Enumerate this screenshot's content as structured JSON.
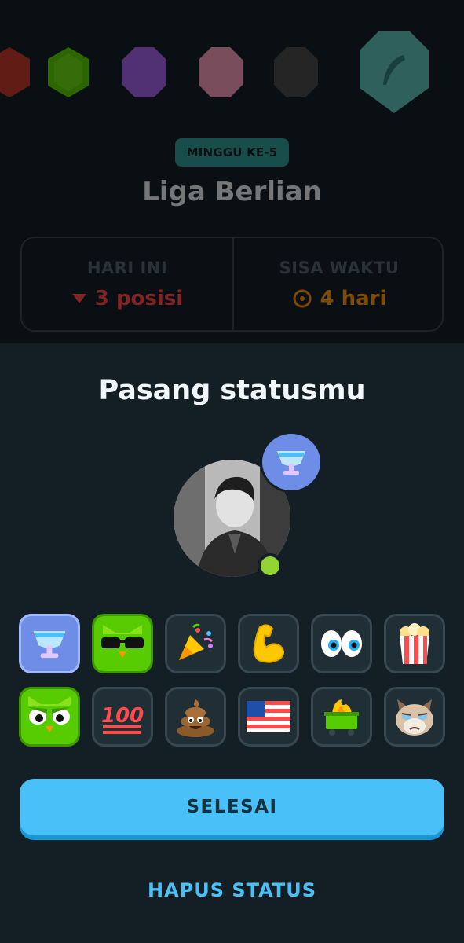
{
  "league": {
    "week_label": "MINGGU KE-5",
    "title": "Liga Berlian",
    "stats": {
      "today_label": "HARI INI",
      "today_value": "3 posisi",
      "remaining_label": "SISA WAKTU",
      "remaining_value": "4 hari"
    },
    "badges": [
      {
        "name": "ruby-league-badge",
        "color": "#c0392b"
      },
      {
        "name": "emerald-league-badge",
        "color": "#58cc02"
      },
      {
        "name": "amethyst-league-badge",
        "color": "#a560e8"
      },
      {
        "name": "pearl-league-badge",
        "color": "#f49ab8"
      },
      {
        "name": "obsidian-league-badge",
        "color": "#4b4b4b"
      },
      {
        "name": "diamond-league-badge",
        "color": "#60c1b8"
      }
    ]
  },
  "sheet": {
    "title": "Pasang statusmu",
    "selected_status": "trophy-icon",
    "status_options": [
      {
        "name": "trophy-icon",
        "selected": true
      },
      {
        "name": "cool-owl-icon",
        "selected": false
      },
      {
        "name": "party-popper-icon",
        "selected": false
      },
      {
        "name": "flexed-bicep-icon",
        "selected": false
      },
      {
        "name": "eyes-icon",
        "selected": false
      },
      {
        "name": "popcorn-icon",
        "selected": false
      },
      {
        "name": "angry-owl-icon",
        "selected": false
      },
      {
        "name": "hundred-points-icon",
        "selected": false
      },
      {
        "name": "poop-icon",
        "selected": false
      },
      {
        "name": "us-flag-icon",
        "selected": false
      },
      {
        "name": "dumpster-fire-icon",
        "selected": false
      },
      {
        "name": "grumpy-cat-icon",
        "selected": false
      }
    ],
    "done_label": "SELESAI",
    "clear_label": "HAPUS STATUS"
  },
  "colors": {
    "background": "#131f24",
    "accent_blue": "#49c0f8",
    "selected_tile": "#6d8de6",
    "online": "#93d333",
    "down_red": "#ff4b4b",
    "timer_orange": "#ff9600"
  }
}
